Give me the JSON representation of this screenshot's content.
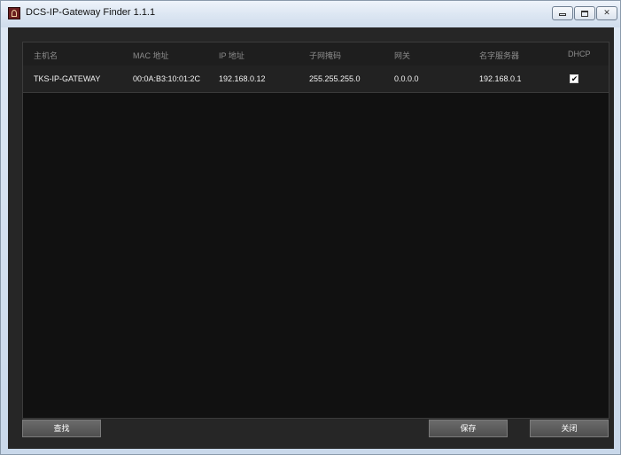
{
  "window": {
    "title": "DCS-IP-Gateway Finder 1.1.1"
  },
  "table": {
    "columns": [
      "主机名",
      "MAC 地址",
      "IP 地址",
      "子网掩码",
      "网关",
      "名字服务器",
      "DHCP"
    ],
    "rows": [
      {
        "hostname": "TKS-IP-GATEWAY",
        "mac": "00:0A:B3:10:01:2C",
        "ip": "192.168.0.12",
        "subnet": "255.255.255.0",
        "gateway": "0.0.0.0",
        "dns": "192.168.0.1",
        "dhcp": true
      }
    ]
  },
  "buttons": {
    "find": "查找",
    "save": "保存",
    "close": "关闭"
  },
  "colors": {
    "background": "#262626",
    "grid": "#111111",
    "header_text": "#8c8c8c",
    "row_text": "#f2f2f2"
  }
}
